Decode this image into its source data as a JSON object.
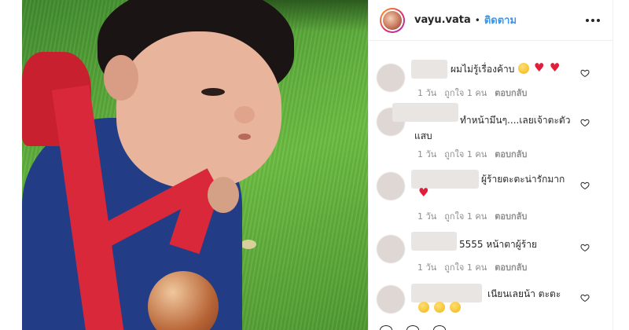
{
  "post": {
    "owner": "vayu.vata",
    "separator": "•",
    "follow_label": "ติดตาม"
  },
  "comments": [
    {
      "text": "ผมไม่รู้เรื่องค้าบ",
      "emojis": [
        "rolling-laughing-emoji",
        "red-heart-emoji",
        "red-heart-emoji"
      ],
      "time": "1 วัน",
      "likes": "ถูกใจ 1 คน",
      "reply": "ตอบกลับ"
    },
    {
      "text": "ทำหน้ามึนๆ....เลยเจ้าตะตัวแสบ",
      "emojis": [],
      "time": "1 วัน",
      "likes": "ถูกใจ 1 คน",
      "reply": "ตอบกลับ"
    },
    {
      "text": "ผู้ร้ายตะตะน่ารักมาก",
      "emojis": [
        "red-heart-emoji"
      ],
      "time": "1 วัน",
      "likes": "ถูกใจ 1 คน",
      "reply": "ตอบกลับ"
    },
    {
      "text": "5555 หน้าตาผู้ร้าย",
      "emojis": [],
      "time": "1 วัน",
      "likes": "ถูกใจ 1 คน",
      "reply": "ตอบกลับ"
    },
    {
      "text": "เนียนเลยน้า ตะตะ",
      "emojis": [
        "grinning-sweat-emoji",
        "grinning-sweat-emoji",
        "grinning-sweat-emoji"
      ],
      "time": "",
      "likes": "",
      "reply": ""
    }
  ],
  "colors": {
    "accent": "#3897f0",
    "text": "#262626",
    "meta": "#8e8e8e"
  }
}
